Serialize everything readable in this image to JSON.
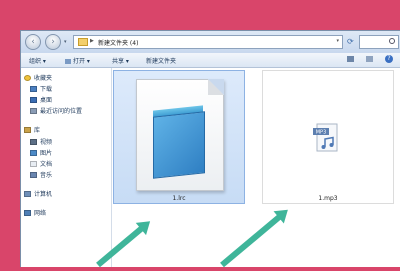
{
  "address": {
    "path": "新建文件夹 (4)",
    "nav_arrow": "▶",
    "dropdown": "▾",
    "refresh": "⟳"
  },
  "toolbar": {
    "organize": "组织 ▾",
    "open": "打开 ▾",
    "share": "共享 ▾",
    "new_folder": "新建文件夹",
    "help": "?"
  },
  "sidebar": {
    "favorites": "收藏夹",
    "downloads": "下载",
    "desktop": "桌面",
    "recent": "最近访问的位置",
    "libraries": "库",
    "videos": "视频",
    "pictures": "图片",
    "documents": "文档",
    "music": "音乐",
    "computer": "计算机",
    "network": "网络"
  },
  "files": [
    {
      "name": "1.lrc",
      "icon": "notepad-document-icon",
      "selected": true
    },
    {
      "name": "1.mp3",
      "icon": "mp3-audio-icon",
      "selected": false
    }
  ],
  "colors": {
    "background": "#d9456a",
    "arrow": "#3fb59a",
    "selection": "#c7dcf5"
  }
}
